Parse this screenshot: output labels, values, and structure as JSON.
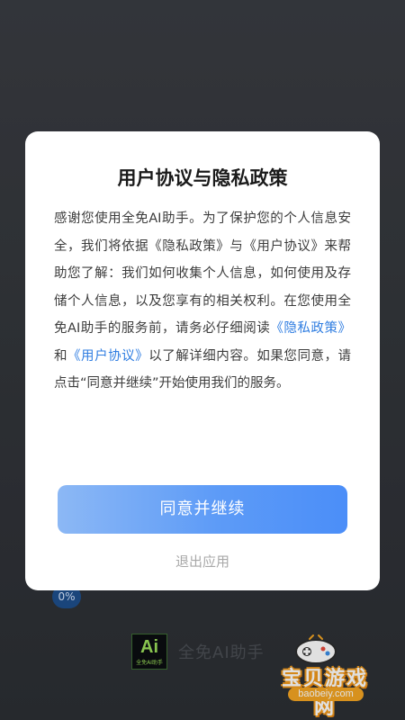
{
  "background": {
    "progress_badge": "0%",
    "logo_main": "Ai",
    "logo_sub": "全免AI助手",
    "brand_name": "全免AI助手"
  },
  "watermark": {
    "title": "宝贝游戏网",
    "url": "baobeiy.com"
  },
  "dialog": {
    "title": "用户协议与隐私政策",
    "body_part1": "感谢您使用全免AI助手。为了保护您的个人信息安全，我们将依据《隐私政策》与《用户协议》来帮助您了解：我们如何收集个人信息，如何使用及存储个人信息，以及您享有的相关权利。在您使用全免AI助手的服务前，请务必仔细阅读",
    "privacy_link": "《隐私政策》",
    "conjunction": "和",
    "user_agreement_link": "《用户协议》",
    "body_part2": "以了解详细内容。如果您同意，请点击“同意并继续”开始使用我们的服务。",
    "agree_button": "同意并继续",
    "exit_button": "退出应用"
  },
  "colors": {
    "link": "#2f7de1",
    "button_gradient_start": "#8cb8f5",
    "button_gradient_end": "#4b8ef8",
    "exit_text": "#a8a8a8"
  }
}
